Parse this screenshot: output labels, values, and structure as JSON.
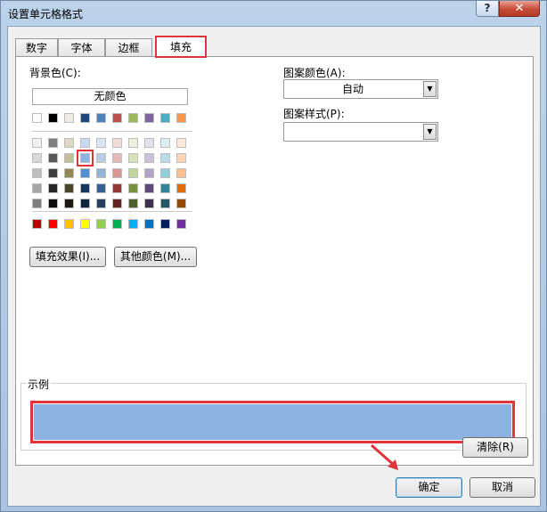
{
  "window": {
    "title": "设置单元格格式",
    "help_label": "?",
    "close_label": "✕"
  },
  "tabs": [
    {
      "label": "数字"
    },
    {
      "label": "字体"
    },
    {
      "label": "边框"
    },
    {
      "label": "填充",
      "active": true
    }
  ],
  "fill": {
    "background_label": "背景色(C):",
    "no_color_label": "无颜色",
    "theme_row": [
      "#ffffff",
      "#000000",
      "#eeece1",
      "#1f497d",
      "#4f81bd",
      "#c0504d",
      "#9bbb59",
      "#8064a2",
      "#4bacc6",
      "#f79646"
    ],
    "tint_rows": [
      [
        "#f2f2f2",
        "#7f7f7f",
        "#ddd9c3",
        "#c6d9f0",
        "#dbe5f1",
        "#f2dcdb",
        "#ebf1dd",
        "#e5e0ec",
        "#dbeef3",
        "#fdeada"
      ],
      [
        "#d8d8d8",
        "#595959",
        "#c4bd97",
        "#8db3e2",
        "#b8cce4",
        "#e5b9b7",
        "#d7e3bc",
        "#ccc1d9",
        "#b7dde8",
        "#fbd5b5"
      ],
      [
        "#bfbfbf",
        "#3f3f3f",
        "#938953",
        "#548dd4",
        "#95b3d7",
        "#d99694",
        "#c3d69b",
        "#b2a2c7",
        "#92cddc",
        "#fac08f"
      ],
      [
        "#a5a5a5",
        "#262626",
        "#494429",
        "#17365d",
        "#366092",
        "#953734",
        "#76923c",
        "#5f497a",
        "#31859b",
        "#e36c09"
      ],
      [
        "#7f7f7f",
        "#0c0c0c",
        "#1d1b10",
        "#0f243e",
        "#244061",
        "#632423",
        "#4f6128",
        "#3f3151",
        "#205867",
        "#974806"
      ]
    ],
    "standard_row": [
      "#c00000",
      "#ff0000",
      "#ffc000",
      "#ffff00",
      "#92d050",
      "#00b050",
      "#00b0f0",
      "#0070c0",
      "#002060",
      "#7030a0"
    ],
    "selected_color": "#8db3e2",
    "fill_effects_label": "填充效果(I)...",
    "more_colors_label": "其他颜色(M)...",
    "pattern_color_label": "图案颜色(A):",
    "pattern_color_value": "自动",
    "pattern_style_label": "图案样式(P):",
    "pattern_style_value": ""
  },
  "sample": {
    "label": "示例",
    "color": "#8db3e2"
  },
  "footer": {
    "clear_label": "清除(R)",
    "ok_label": "确定",
    "cancel_label": "取消"
  },
  "accent_annotation": "#e0333a"
}
